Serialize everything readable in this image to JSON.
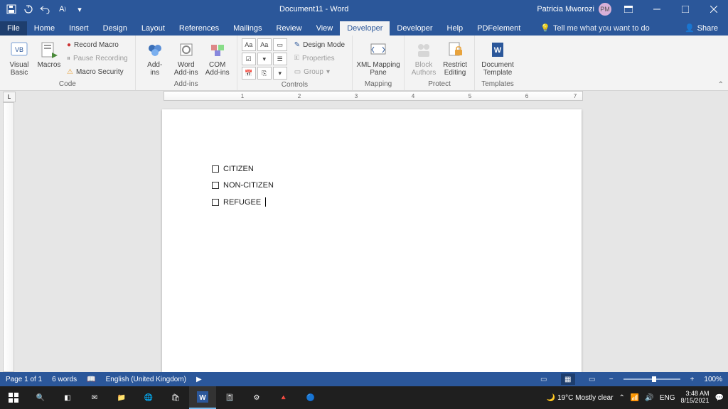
{
  "titlebar": {
    "doc_title": "Document11 - Word",
    "user_name": "Patricia Mworozi",
    "user_initials": "PM"
  },
  "tabs": {
    "items": [
      "File",
      "Home",
      "Insert",
      "Design",
      "Layout",
      "References",
      "Mailings",
      "Review",
      "View",
      "Developer",
      "Developer",
      "Help",
      "PDFelement"
    ],
    "active_index": 9,
    "tell_me": "Tell me what you want to do",
    "share": "Share"
  },
  "ribbon": {
    "code": {
      "visual_basic": "Visual\nBasic",
      "macros": "Macros",
      "record": "Record Macro",
      "pause": "Pause Recording",
      "security": "Macro Security",
      "label": "Code"
    },
    "addins": {
      "addins": "Add-\nins",
      "word": "Word\nAdd-ins",
      "com": "COM\nAdd-ins",
      "label": "Add-ins"
    },
    "controls": {
      "design": "Design Mode",
      "properties": "Properties",
      "group": "Group",
      "label": "Controls"
    },
    "mapping": {
      "xml": "XML Mapping\nPane",
      "label": "Mapping"
    },
    "protect": {
      "block": "Block\nAuthors",
      "restrict": "Restrict\nEditing",
      "label": "Protect"
    },
    "templates": {
      "doc": "Document\nTemplate",
      "label": "Templates"
    }
  },
  "document": {
    "lines": [
      "CITIZEN",
      "NON-CITIZEN",
      "REFUGEE"
    ]
  },
  "statusbar": {
    "page": "Page 1 of 1",
    "words": "6 words",
    "lang": "English (United Kingdom)",
    "zoom": "100%"
  },
  "taskbar": {
    "weather": "19°C Mostly clear",
    "lang": "ENG",
    "time": "3:48 AM",
    "date": "8/15/2021"
  }
}
